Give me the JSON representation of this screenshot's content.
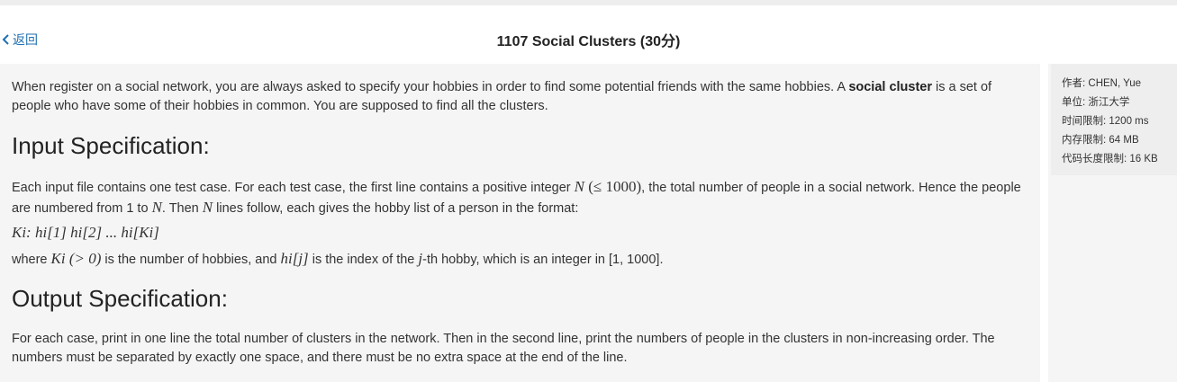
{
  "header": {
    "back_label": "返回",
    "title": "1107 Social Clusters (30分)"
  },
  "problem": {
    "intro_pre": "When register on a social network, you are always asked to specify your hobbies in order to find some potential friends with the same hobbies. A ",
    "intro_bold": "social cluster",
    "intro_post": " is a set of people who have some of their hobbies in common. You are supposed to find all the clusters.",
    "input_heading": "Input Specification:",
    "input_p1_a": "Each input file contains one test case. For each test case, the first line contains a positive integer ",
    "input_p1_N": "N",
    "input_p1_b": " (≤ 1000)",
    "input_p1_c": ", the total number of people in a social network. Hence the people are numbered from 1 to ",
    "input_p1_N2": "N",
    "input_p1_d": ". Then ",
    "input_p1_N3": "N",
    "input_p1_e": " lines follow, each gives the hobby list of a person in the format:",
    "format_line": "Ki: hi[1] hi[2] ... hi[Ki]",
    "where_a": "where ",
    "where_K": "Ki (> 0)",
    "where_b": " is the number of hobbies, and ",
    "where_h": "hi[j]",
    "where_c": " is the index of the ",
    "where_j": "j",
    "where_d": "-th hobby, which is an integer in [1, 1000].",
    "output_heading": "Output Specification:",
    "output_text": "For each case, print in one line the total number of clusters in the network. Then in the second line, print the numbers of people in the clusters in non-increasing order. The numbers must be separated by exactly one space, and there must be no extra space at the end of the line."
  },
  "info": {
    "author": "作者: CHEN, Yue",
    "unit": "单位: 浙江大学",
    "time_limit": "时间限制: 1200 ms",
    "memory_limit": "内存限制: 64 MB",
    "code_limit": "代码长度限制: 16 KB"
  }
}
